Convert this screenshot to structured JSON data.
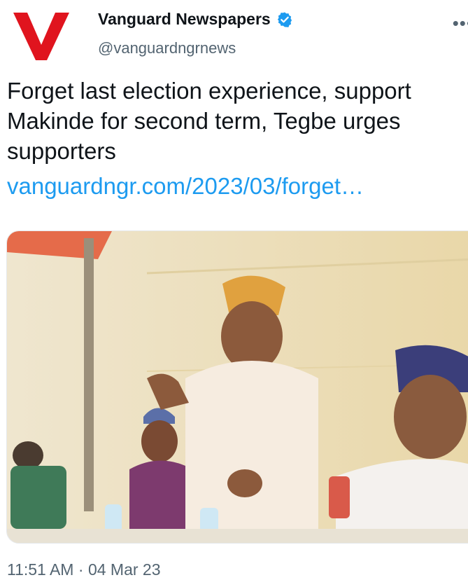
{
  "account": {
    "display_name": "Vanguard Newspapers",
    "handle": "@vanguardngrnews",
    "verified": true,
    "avatar_icon": "vanguard-v-logo",
    "avatar_letter": "V",
    "brand_color": "#e0141e",
    "verified_color": "#1d9bf0"
  },
  "tweet": {
    "text": "Forget last election experience, support Makinde for second term, Tegbe urges supporters",
    "link": "vanguardngr.com/2023/03/forget…",
    "link_color": "#1d9bf0",
    "image_icon": "news-photo-of-men-seated-at-table"
  },
  "meta": {
    "time": "11:51 AM",
    "separator": "·",
    "date": "04 Mar 23"
  }
}
